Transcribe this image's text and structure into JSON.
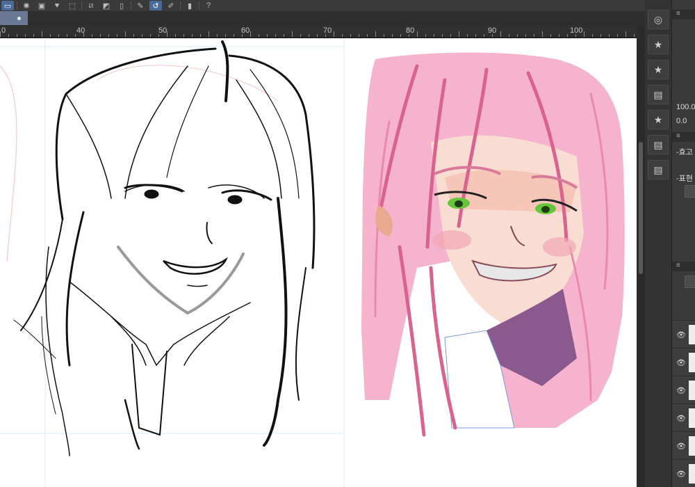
{
  "ruler": {
    "labels": [
      "0",
      "40",
      "50",
      "60",
      "70",
      "80",
      "90",
      "100"
    ]
  },
  "panel": {
    "value_top": "100.0",
    "value_bottom": "0.0",
    "section1_label": "-효고",
    "section2_label": "-표현"
  },
  "colors": {
    "chrome_dark": "#2b2b2b",
    "accent_active": "#4a6a9a",
    "hair_pink": "#f2a6c4",
    "hair_dark_pink": "#d9628f",
    "eye_green": "#66c63a",
    "skin": "#f8d8cc",
    "collar_purple": "#8a5a8e"
  },
  "icons": {
    "toolbar": [
      "layer-icon",
      "sparkle-icon",
      "layer-stack-icon",
      "heart-fill-icon",
      "transform-icon",
      "line-pattern-icon",
      "gradient-icon",
      "page-icon",
      "pen-check-icon",
      "lasso-icon",
      "pen-ruler-icon",
      "phone-icon",
      "help-icon"
    ],
    "side": [
      "navigator-icon",
      "star-icon",
      "folder-star-icon",
      "layer-props-icon",
      "folder-star-icon",
      "layer-props-icon",
      "layer-props-icon"
    ]
  }
}
